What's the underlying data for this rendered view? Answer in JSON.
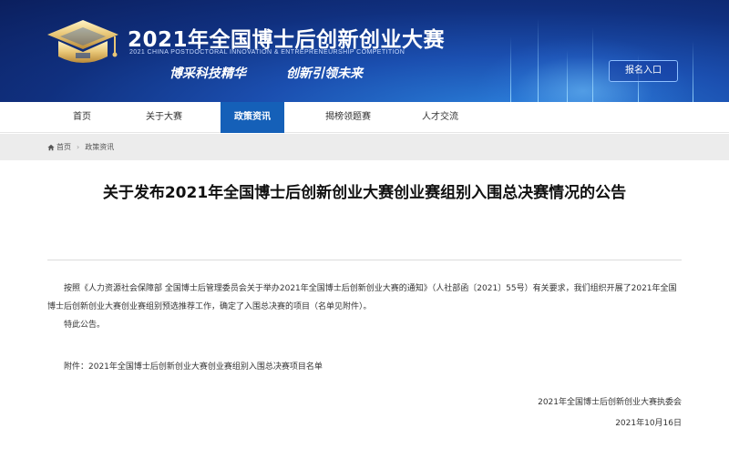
{
  "banner": {
    "title": "2021年全国博士后创新创业大赛",
    "subtitle": "2021 CHINA POSTDOCTORAL INNOVATION & ENTREPRENEURSHIP COMPETITION",
    "slogan_left": "博采科技精华",
    "slogan_right": "创新引领未来",
    "register_label": "报名入口",
    "logo_icon": "graduation-cap-logo"
  },
  "nav": {
    "items": [
      {
        "label": "首页"
      },
      {
        "label": "关于大赛"
      },
      {
        "label": "政策资讯"
      },
      {
        "label": "揭榜领题赛"
      },
      {
        "label": "人才交流"
      }
    ],
    "active_index": 2,
    "active_color": "#1560b8"
  },
  "breadcrumb": {
    "home_icon": "home-icon",
    "home_label": "首页",
    "current_label": "政策资讯"
  },
  "article": {
    "title": "关于发布2021年全国博士后创新创业大赛创业赛组别入围总决赛情况的公告",
    "paragraphs": [
      "按照《人力资源社会保障部 全国博士后管理委员会关于举办2021年全国博士后创新创业大赛的通知》（人社部函〔2021〕55号）有关要求，我们组织开展了2021年全国博士后创新创业大赛创业赛组别预选推荐工作，确定了入围总决赛的项目（名单见附件）。",
      "特此公告。",
      "附件：2021年全国博士后创新创业大赛创业赛组别入围总决赛项目名单"
    ],
    "signature_org": "2021年全国博士后创新创业大赛执委会",
    "signature_date": "2021年10月16日"
  }
}
